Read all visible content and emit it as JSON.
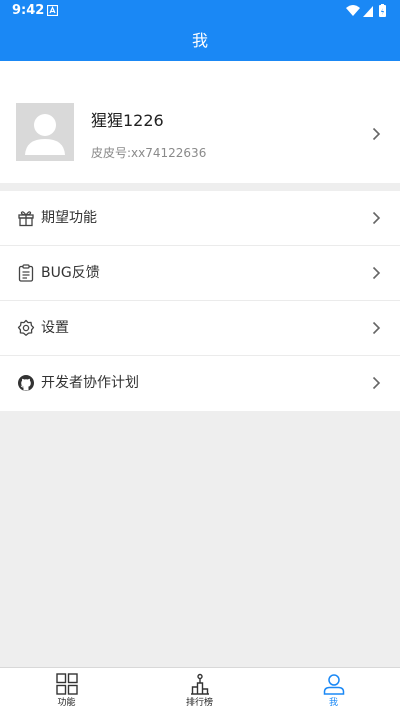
{
  "status_bar": {
    "time": "9:42"
  },
  "header": {
    "title": "我"
  },
  "profile": {
    "username": "猩猩1226",
    "user_id": "皮皮号:xx74122636"
  },
  "menu": {
    "items": [
      {
        "label": "期望功能",
        "icon": "gift-icon"
      },
      {
        "label": "BUG反馈",
        "icon": "clipboard-icon"
      },
      {
        "label": "设置",
        "icon": "settings-icon"
      },
      {
        "label": "开发者协作计划",
        "icon": "github-icon"
      }
    ]
  },
  "bottom_nav": {
    "items": [
      {
        "label": "功能",
        "icon": "grid-icon"
      },
      {
        "label": "排行榜",
        "icon": "podium-icon"
      },
      {
        "label": "我",
        "icon": "person-icon",
        "active": true
      }
    ]
  },
  "colors": {
    "primary": "#1a88f5",
    "background": "#eeeeee",
    "avatar_placeholder": "#d9d9d9"
  }
}
